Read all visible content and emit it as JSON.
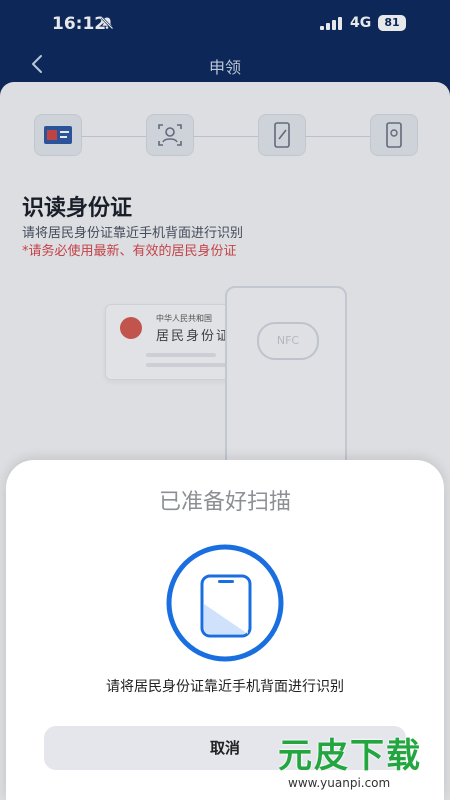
{
  "status": {
    "time": "16:12",
    "network": "4G",
    "battery": "81"
  },
  "nav": {
    "title": "申领"
  },
  "page": {
    "heading": "识读身份证",
    "subtitle": "请将居民身份证靠近手机背面进行识别",
    "warning": "*请务必使用最新、有效的居民身份证"
  },
  "illustration": {
    "card_line1": "中华人民共和国",
    "card_line2": "居民身份证",
    "nfc_label": "NFC"
  },
  "sheet": {
    "title": "已准备好扫描",
    "message": "请将居民身份证靠近手机背面进行识别",
    "cancel_label": "取消"
  },
  "watermark": {
    "text": "元皮下载",
    "url": "www.yuanpi.com"
  },
  "colors": {
    "header_bg": "#0d2a5e",
    "accent_blue": "#1a6fe0",
    "warning_red": "#d9474d",
    "watermark_green": "#23a640"
  },
  "icons": [
    "bell-muted-icon",
    "signal-icon",
    "back-arrow-icon",
    "id-card-icon",
    "face-scan-icon",
    "phone-edit-icon",
    "phone-check-icon",
    "phone-scan-icon"
  ]
}
